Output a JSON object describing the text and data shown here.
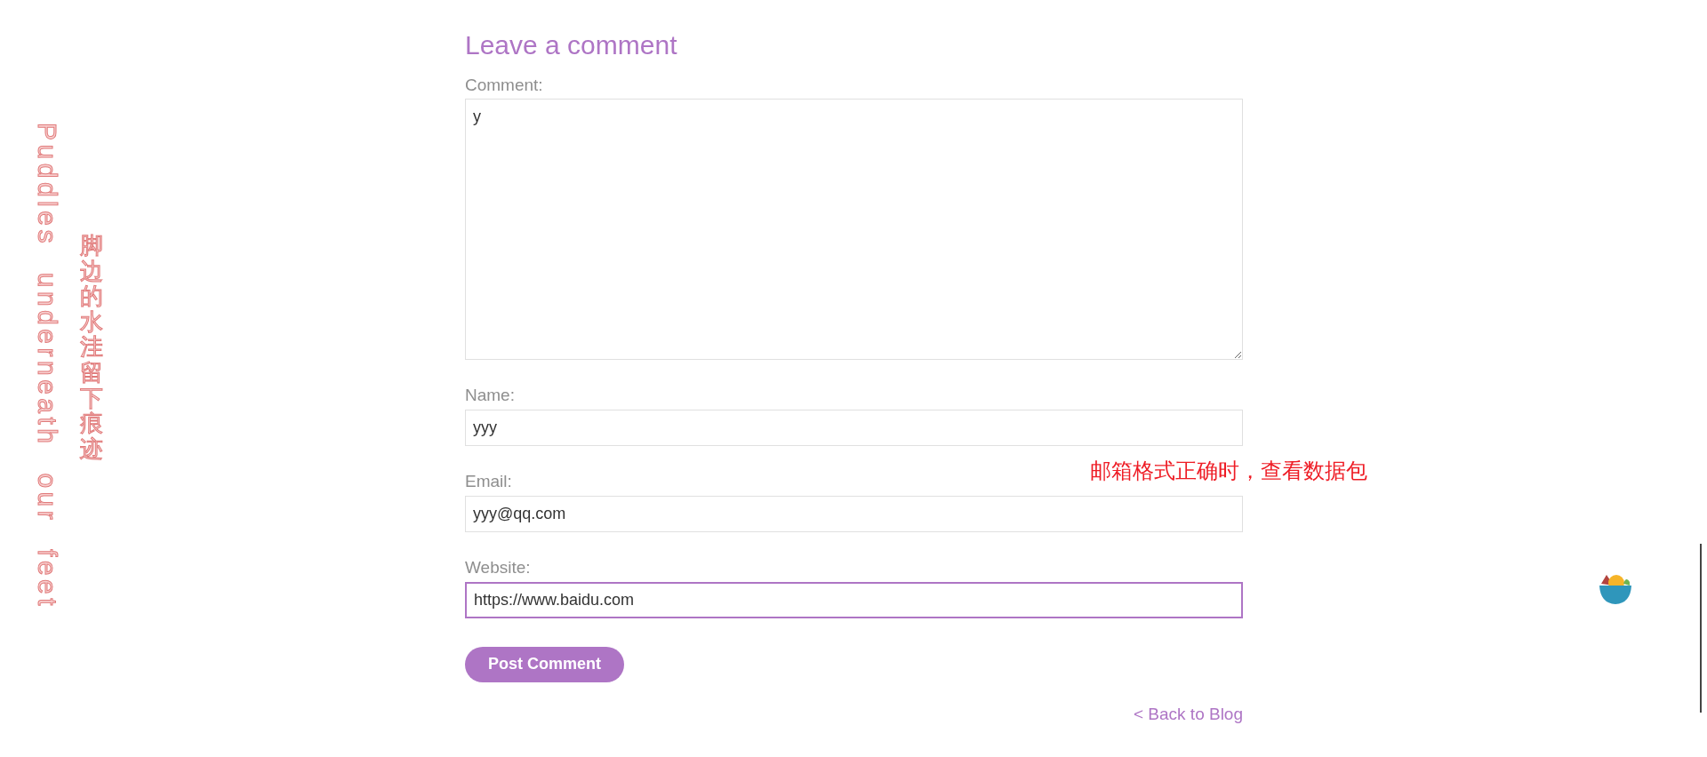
{
  "side_text": {
    "english": "Puddles underneath our feet",
    "chinese": "脚边的水洼留下痕迹"
  },
  "form": {
    "title": "Leave a comment",
    "fields": [
      {
        "kind": "textarea",
        "label": "Comment:",
        "value": "y",
        "focused": false
      },
      {
        "kind": "input",
        "label": "Name:",
        "value": "yyy",
        "focused": false
      },
      {
        "kind": "input",
        "label": "Email:",
        "value": "yyy@qq.com",
        "focused": false
      },
      {
        "kind": "input",
        "label": "Website:",
        "value": "https://www.baidu.com",
        "focused": true
      }
    ],
    "submit": "Post Comment",
    "back_link": "< Back to Blog"
  },
  "annotation": "邮箱格式正确时，查看数据包"
}
